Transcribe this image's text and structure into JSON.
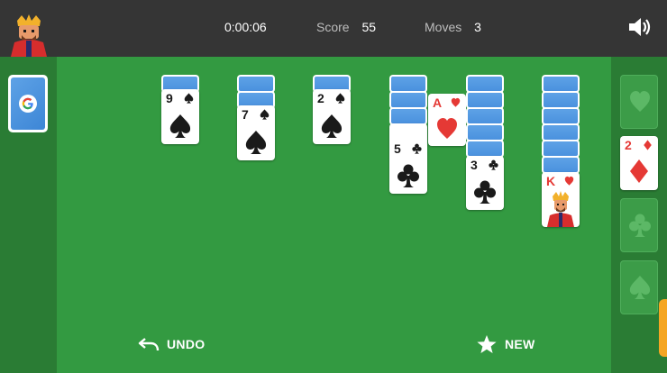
{
  "header": {
    "timer": "0:00:06",
    "score_label": "Score",
    "score_value": "55",
    "moves_label": "Moves",
    "moves_value": "3",
    "avatar_icon": "king-avatar-icon",
    "sound_icon": "speaker-icon"
  },
  "stock": {
    "logo_letter": "G"
  },
  "tableau": [
    {
      "facedown": 1,
      "card": {
        "rank": "9",
        "suit": "spade"
      }
    },
    {
      "facedown": 2,
      "card": {
        "rank": "7",
        "suit": "spade"
      }
    },
    {
      "facedown": 1,
      "card": {
        "rank": "2",
        "suit": "spade"
      }
    },
    {
      "facedown": 3,
      "card": {
        "rank": "5",
        "suit": "club"
      },
      "floating": {
        "rank": "A",
        "suit": "heart"
      }
    },
    {
      "facedown": 5,
      "card": {
        "rank": "3",
        "suit": "club"
      }
    },
    {
      "facedown": 6,
      "card": {
        "rank": "K",
        "suit": "heart"
      }
    }
  ],
  "foundations": [
    {
      "suit": "heart",
      "top_card": null
    },
    {
      "suit": "diamond",
      "top_card": "2"
    },
    {
      "suit": "club",
      "top_card": null
    },
    {
      "suit": "spade",
      "top_card": null
    }
  ],
  "actions": {
    "undo_label": "UNDO",
    "new_label": "NEW"
  },
  "colors": {
    "felt": "#339a41",
    "side": "#2a7c34",
    "topbar": "#353535",
    "red_suit": "#e53935",
    "black_suit": "#1a1a1a",
    "card_back": "#4a91de"
  }
}
